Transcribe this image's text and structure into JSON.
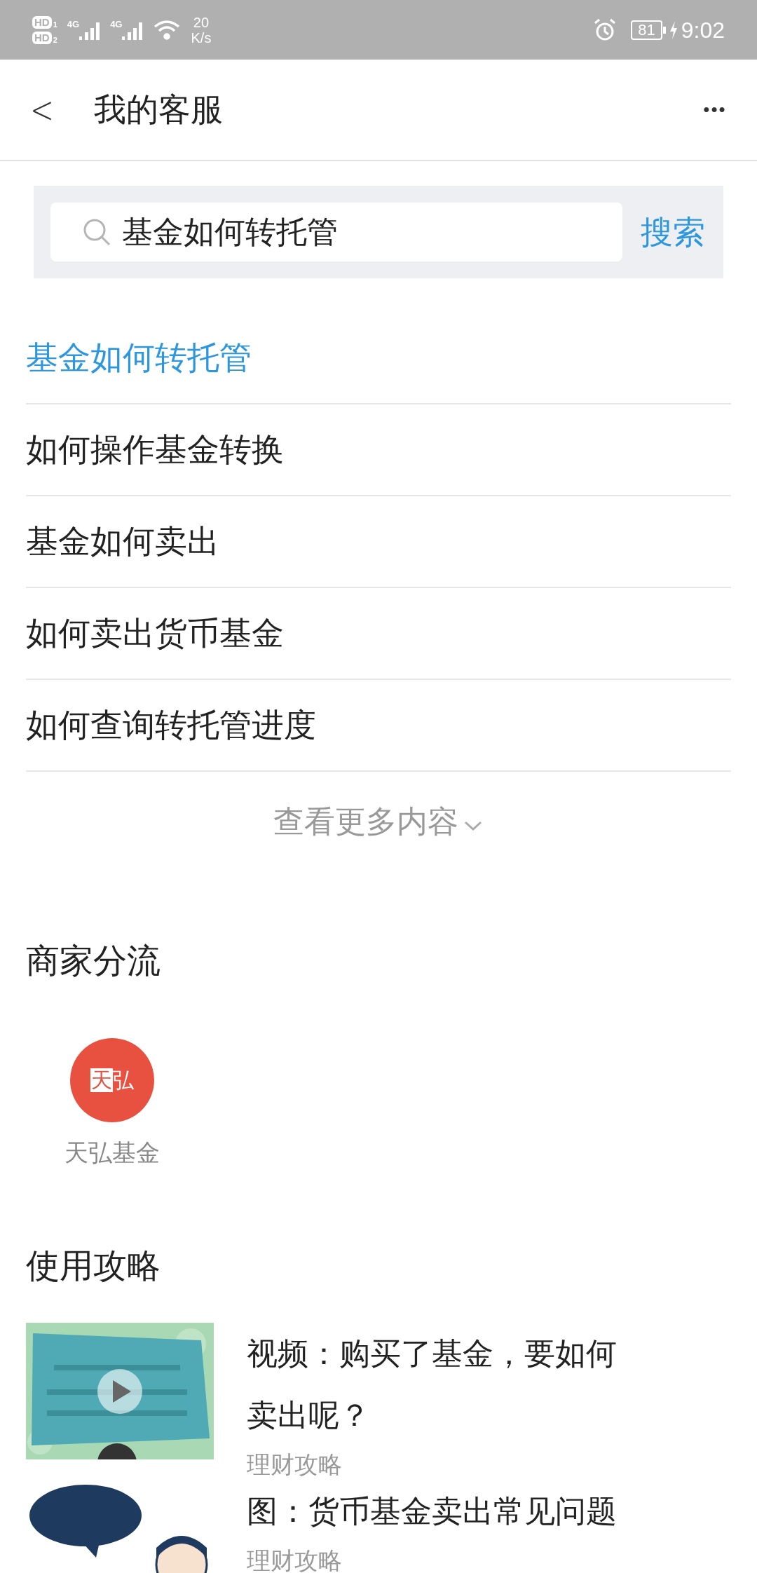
{
  "status_bar": {
    "sims": [
      {
        "label": "HD",
        "slot": "1"
      },
      {
        "label": "HD",
        "slot": "2"
      }
    ],
    "networks": [
      "4G",
      "4G"
    ],
    "speed_value": "20",
    "speed_unit": "K/s",
    "battery": "81",
    "time": "9:02"
  },
  "header": {
    "back": "<",
    "title": "我的客服",
    "more": "•••"
  },
  "search": {
    "value": "基金如何转托管",
    "button": "搜索"
  },
  "suggestions": [
    {
      "text": "基金如何转托管",
      "selected": true
    },
    {
      "text": "如何操作基金转换",
      "selected": false
    },
    {
      "text": "基金如何卖出",
      "selected": false
    },
    {
      "text": "如何卖出货币基金",
      "selected": false
    },
    {
      "text": "如何查询转托管进度",
      "selected": false
    }
  ],
  "more_link": "查看更多内容",
  "merchants": {
    "title": "商家分流",
    "items": [
      {
        "logo_boxed": "天",
        "logo_plain": "弘",
        "name": "天弘基金",
        "color": "#e8503f"
      }
    ]
  },
  "guides": {
    "title": "使用攻略",
    "items": [
      {
        "kind": "video",
        "title": "视频：购买了基金，要如何卖出呢？",
        "tag": "理财攻略"
      },
      {
        "title": "图：货币基金卖出常见问题",
        "tag": "理财攻略"
      }
    ]
  }
}
